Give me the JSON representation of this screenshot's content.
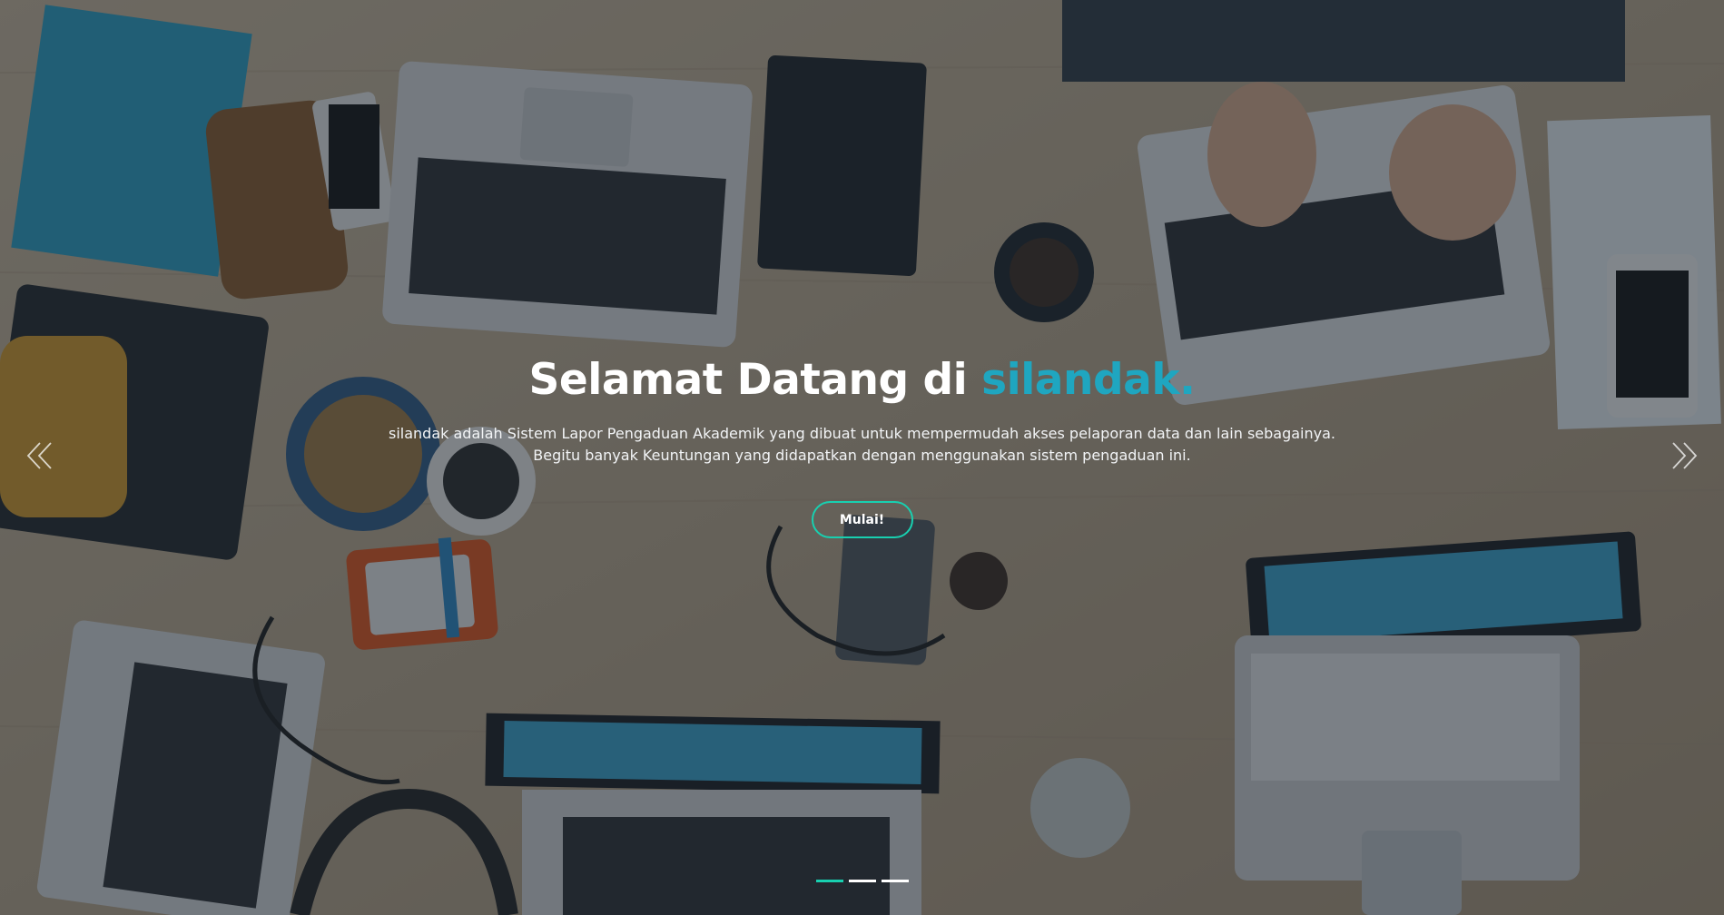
{
  "hero": {
    "headline_main": "Selamat Datang di ",
    "headline_accent": "silandak.",
    "description_line1": "silandak adalah Sistem Lapor Pengaduan Akademik yang dibuat untuk mempermudah akses pelaporan data dan lain sebagainya.",
    "description_line2": "Begitu banyak Keuntungan yang didapatkan dengan menggunakan sistem pengaduan ini.",
    "cta_label": "Mulai!"
  },
  "carousel": {
    "prev_icon": "double-chevron-left-icon",
    "next_icon": "double-chevron-right-icon",
    "indicator_count": 3,
    "active_index": 0
  },
  "colors": {
    "accent": "#1fa6c0",
    "button_border": "#18d0b0",
    "overlay": "rgba(24,34,44,0.52)"
  }
}
